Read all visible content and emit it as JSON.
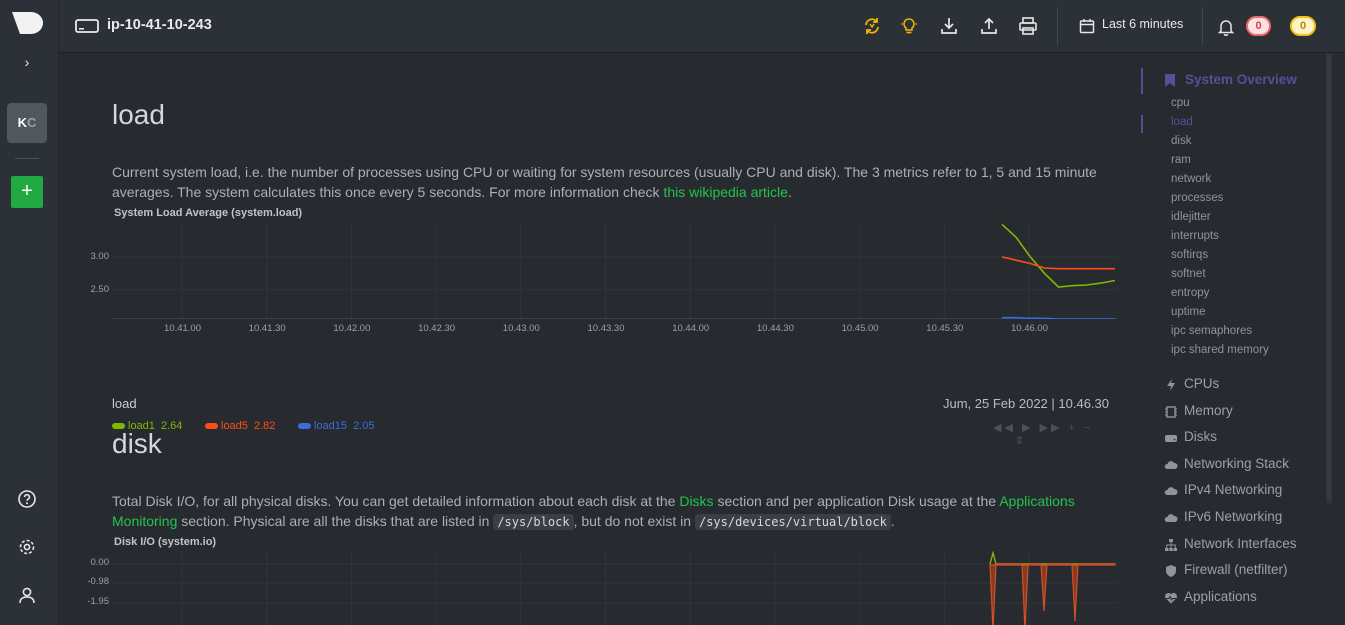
{
  "header": {
    "hostname": "ip-10-41-10-243",
    "time_range": "Last 6 minutes",
    "alarms_critical": "0",
    "alarms_warning": "0"
  },
  "sidebar": {
    "avatar_initials": [
      "K",
      "C"
    ],
    "add_label": "+"
  },
  "sections": {
    "load": {
      "title": "load",
      "description": "Current system load, i.e. the number of processes using CPU or waiting for system resources (usually CPU and disk). The 3 metrics refer to 1, 5 and 15 minute averages. The system calculates this once every 5 seconds. For more information check ",
      "link_text": "this wikipedia article",
      "description_end": ".",
      "chart_title": "System Load Average (system.load)",
      "legend_name": "load",
      "legend_date": "Jum, 25 Feb 2022 | 10.46.30"
    },
    "disk": {
      "title": "disk",
      "desc_part1": "Total Disk I/O, for all physical disks. You can get detailed information about each disk at the ",
      "desc_link1": "Disks",
      "desc_part2": " section and per application Disk usage at the ",
      "desc_link2": "Applications Monitoring",
      "desc_part3": " section. Physical are all the disks that are listed in ",
      "desc_code1": "/sys/block",
      "desc_part4": ", but do not exist in ",
      "desc_code2": "/sys/devices/virtual/block",
      "desc_part5": ".",
      "chart_title": "Disk I/O (system.io)"
    }
  },
  "chart_data": [
    {
      "type": "line",
      "title": "System Load Average (system.load)",
      "x_tick_labels": [
        "10.41.00",
        "10.41.30",
        "10.42.00",
        "10.42.30",
        "10.43.00",
        "10.43.30",
        "10.44.00",
        "10.44.30",
        "10.45.00",
        "10.45.30",
        "10.46.00"
      ],
      "y_tick_labels": [
        "3.00",
        "2.50"
      ],
      "ylim": [
        2.05,
        3.55
      ],
      "x": [
        "10.45.50",
        "10.45.55",
        "10.46.00",
        "10.46.05",
        "10.46.10",
        "10.46.15",
        "10.46.20",
        "10.46.25",
        "10.46.30"
      ],
      "series": [
        {
          "name": "load1",
          "color": "#7fb800",
          "values": [
            3.5,
            3.3,
            3.0,
            2.75,
            2.54,
            2.56,
            2.57,
            2.6,
            2.64
          ]
        },
        {
          "name": "load5",
          "color": "#ff4d1a",
          "values": [
            3.0,
            2.95,
            2.9,
            2.83,
            2.82,
            2.82,
            2.82,
            2.82,
            2.82
          ]
        },
        {
          "name": "load15",
          "color": "#3a6cdd",
          "values": [
            2.07,
            2.07,
            2.06,
            2.06,
            2.05,
            2.05,
            2.05,
            2.05,
            2.05
          ]
        }
      ],
      "legend_values": {
        "load1": "2.64",
        "load5": "2.82",
        "load15": "2.05"
      },
      "grid": true
    },
    {
      "type": "area",
      "title": "Disk I/O (system.io)",
      "y_tick_labels": [
        "0.00",
        "-0.98",
        "-1.95"
      ]
    }
  ],
  "toc": {
    "header": "System Overview",
    "sub_items": [
      "cpu",
      "load",
      "disk",
      "ram",
      "network",
      "processes",
      "idlejitter",
      "interrupts",
      "softirqs",
      "softnet",
      "entropy",
      "uptime",
      "ipc semaphores",
      "ipc shared memory"
    ],
    "active_sub": "load",
    "main_items": [
      {
        "label": "CPUs",
        "icon": "bolt-icon"
      },
      {
        "label": "Memory",
        "icon": "memory-chip-icon"
      },
      {
        "label": "Disks",
        "icon": "hdd-icon"
      },
      {
        "label": "Networking Stack",
        "icon": "cloud-icon"
      },
      {
        "label": "IPv4 Networking",
        "icon": "cloud-icon"
      },
      {
        "label": "IPv6 Networking",
        "icon": "cloud-icon"
      },
      {
        "label": "Network Interfaces",
        "icon": "sitemap-icon"
      },
      {
        "label": "Firewall (netfilter)",
        "icon": "shield-icon"
      },
      {
        "label": "Applications",
        "icon": "heartbeat-icon"
      }
    ]
  }
}
